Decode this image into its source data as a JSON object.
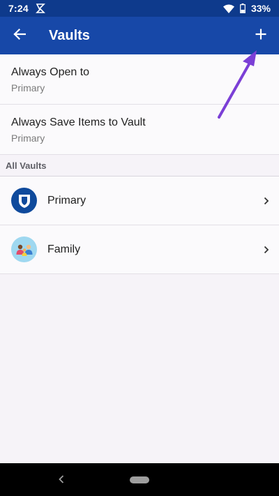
{
  "status_bar": {
    "time": "7:24",
    "battery": "33%",
    "icons": [
      "notification-icon",
      "wifi-icon",
      "battery-icon"
    ]
  },
  "app_bar": {
    "title": "Vaults",
    "back_icon": "back-arrow-icon",
    "add_icon": "plus-icon",
    "color": "#1748a8"
  },
  "settings": [
    {
      "label": "Always Open to",
      "value": "Primary"
    },
    {
      "label": "Always Save Items to Vault",
      "value": "Primary"
    }
  ],
  "all_vaults": {
    "header": "All Vaults",
    "items": [
      {
        "name": "Primary",
        "icon": "primary-vault-icon",
        "icon_color": "#0f4a9c"
      },
      {
        "name": "Family",
        "icon": "family-vault-icon",
        "icon_color": "#9fd8f0"
      }
    ]
  },
  "annotation": {
    "arrow_color": "#7b3fd6",
    "points_to": "add-vault-button"
  },
  "nav_bar": {
    "icons": [
      "nav-back-icon",
      "home-pill"
    ]
  }
}
